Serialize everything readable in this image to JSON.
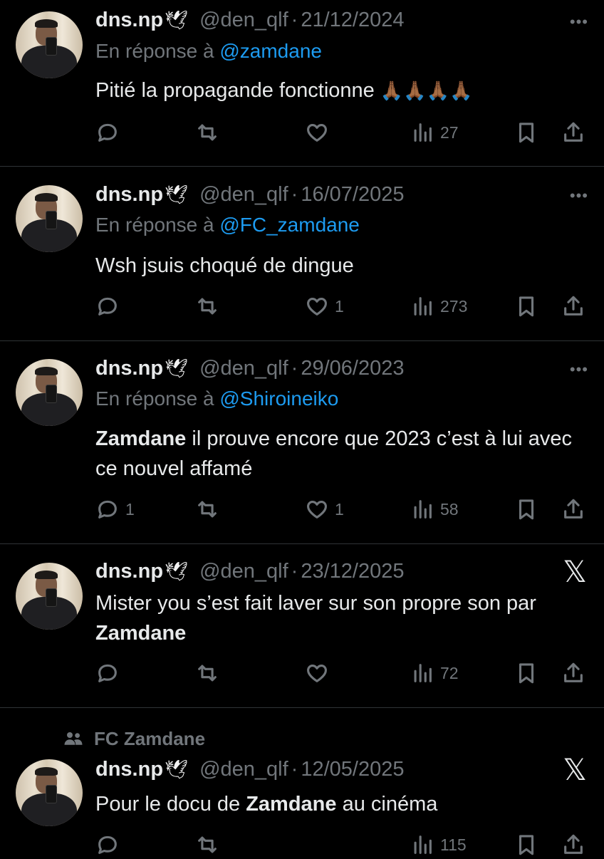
{
  "tweets": [
    {
      "name": "dns.np",
      "badge": "🕊",
      "handle": "@den_qlf",
      "separator": "·",
      "date": "21/12/2024",
      "reply_prefix": "En réponse à",
      "reply_to": "@zamdane",
      "text": "Pitié la propagande fonctionne",
      "emoji": "🙏🏾🙏🏾🙏🏾🙏🏾",
      "more": "•••",
      "likes": "",
      "replies": "",
      "views": "27"
    },
    {
      "name": "dns.np",
      "badge": "🕊",
      "handle": "@den_qlf",
      "separator": "·",
      "date": "16/07/2025",
      "reply_prefix": "En réponse à",
      "reply_to": "@FC_zamdane",
      "text": "Wsh jsuis choqué de dingue",
      "more": "•••",
      "likes": "1",
      "replies": "",
      "views": "273"
    },
    {
      "name": "dns.np",
      "badge": "🕊",
      "handle": "@den_qlf",
      "separator": "·",
      "date": "29/06/2023",
      "reply_prefix": "En réponse à",
      "reply_to": "@Shiroineiko",
      "text_bold": "Zamdane",
      "text_rest": " il prouve encore que 2023 c’est à lui avec ce nouvel affamé",
      "more": "•••",
      "likes": "1",
      "replies": "1",
      "views": "58"
    },
    {
      "name": "dns.np",
      "badge": "🕊",
      "handle": "@den_qlf",
      "separator": "·",
      "date": "23/12/2025",
      "text_pre": "Mister you s’est fait laver sur son propre son par ",
      "text_bold": "Zamdane",
      "x_logo": "𝕏",
      "likes": "",
      "replies": "",
      "views": "72"
    },
    {
      "context": "FC Zamdane",
      "name": "dns.np",
      "badge": "🕊",
      "handle": "@den_qlf",
      "separator": "·",
      "date": "12/05/2025",
      "text_pre": "Pour le docu de ",
      "text_bold": "Zamdane",
      "text_post": " au cinéma",
      "x_logo": "𝕏",
      "views": "115"
    }
  ],
  "colors": {
    "background": "#000000",
    "text": "#e7e9ea",
    "muted": "#71767b",
    "link": "#1d9bf0",
    "divider": "#2f3336"
  }
}
